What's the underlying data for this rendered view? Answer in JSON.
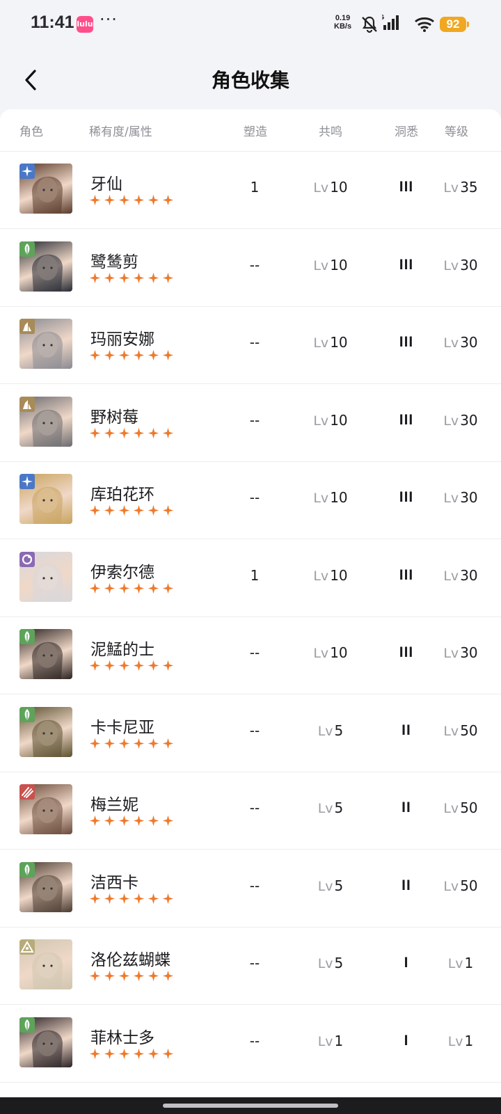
{
  "status": {
    "time": "11:41",
    "app_badge": "lulu",
    "dots": "···",
    "net_speed_value": "0.19",
    "net_speed_unit": "KB/s",
    "network": "5G",
    "battery": "92"
  },
  "header": {
    "title": "角色收集"
  },
  "columns": {
    "role": "角色",
    "rarity": "稀有度/属性",
    "forge": "塑造",
    "resonance": "共鸣",
    "insight": "洞悉",
    "level": "等级"
  },
  "level_prefix": "Lv",
  "characters": [
    {
      "name": "牙仙",
      "attr": "star",
      "attr_color": "#4a78c7",
      "stars": 6,
      "forge": "1",
      "resonance": "10",
      "insight": "III",
      "level": "35",
      "portrait": "#5a3a2a"
    },
    {
      "name": "鹭鸶剪",
      "attr": "plant",
      "attr_color": "#5ea35a",
      "stars": 6,
      "forge": "--",
      "resonance": "10",
      "insight": "III",
      "level": "30",
      "portrait": "#262a33"
    },
    {
      "name": "玛丽安娜",
      "attr": "mineral",
      "attr_color": "#a88b58",
      "stars": 6,
      "forge": "--",
      "resonance": "10",
      "insight": "III",
      "level": "30",
      "portrait": "#8a8a92"
    },
    {
      "name": "野树莓",
      "attr": "mineral",
      "attr_color": "#a88b58",
      "stars": 6,
      "forge": "--",
      "resonance": "10",
      "insight": "III",
      "level": "30",
      "portrait": "#6b6b70"
    },
    {
      "name": "库珀花环",
      "attr": "star",
      "attr_color": "#4a78c7",
      "stars": 6,
      "forge": "--",
      "resonance": "10",
      "insight": "III",
      "level": "30",
      "portrait": "#c8a35c"
    },
    {
      "name": "伊索尔德",
      "attr": "spirit",
      "attr_color": "#8c6ab3",
      "stars": 6,
      "forge": "1",
      "resonance": "10",
      "insight": "III",
      "level": "30",
      "portrait": "#d8d8dc"
    },
    {
      "name": "泥鯭的士",
      "attr": "plant",
      "attr_color": "#5ea35a",
      "stars": 6,
      "forge": "--",
      "resonance": "10",
      "insight": "III",
      "level": "30",
      "portrait": "#2b2220"
    },
    {
      "name": "卡卡尼亚",
      "attr": "plant",
      "attr_color": "#5ea35a",
      "stars": 6,
      "forge": "--",
      "resonance": "5",
      "insight": "II",
      "level": "50",
      "portrait": "#5b5030"
    },
    {
      "name": "梅兰妮",
      "attr": "beast",
      "attr_color": "#c9524e",
      "stars": 6,
      "forge": "--",
      "resonance": "5",
      "insight": "II",
      "level": "50",
      "portrait": "#6a4a3a"
    },
    {
      "name": "洁西卡",
      "attr": "plant",
      "attr_color": "#5ea35a",
      "stars": 6,
      "forge": "--",
      "resonance": "5",
      "insight": "II",
      "level": "50",
      "portrait": "#4a3a30"
    },
    {
      "name": "洛伦兹蝴蝶",
      "attr": "intellect",
      "attr_color": "#b8ab7a",
      "stars": 6,
      "forge": "--",
      "resonance": "5",
      "insight": "I",
      "level": "1",
      "portrait": "#cfc6b0"
    },
    {
      "name": "菲林士多",
      "attr": "plant",
      "attr_color": "#5ea35a",
      "stars": 6,
      "forge": "--",
      "resonance": "1",
      "insight": "I",
      "level": "1",
      "portrait": "#2a2226"
    }
  ]
}
